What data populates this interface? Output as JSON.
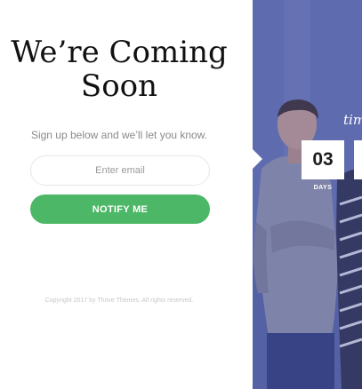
{
  "page": {
    "title": "We’re Coming Soon",
    "subtitle": "Sign up below and we’ll let you know.",
    "email_placeholder": "Enter email",
    "notify_label": "NOTIFY ME",
    "copyright": "Copyright 2017 by Thrive Themes. All rights reserved."
  },
  "countdown": {
    "tagline": "tim",
    "days_value": "03",
    "days_label": "DAYS"
  },
  "colors": {
    "accent": "#4cb766",
    "overlay": "#5a67a9",
    "text": "#111111",
    "muted": "#8a8a8a"
  }
}
